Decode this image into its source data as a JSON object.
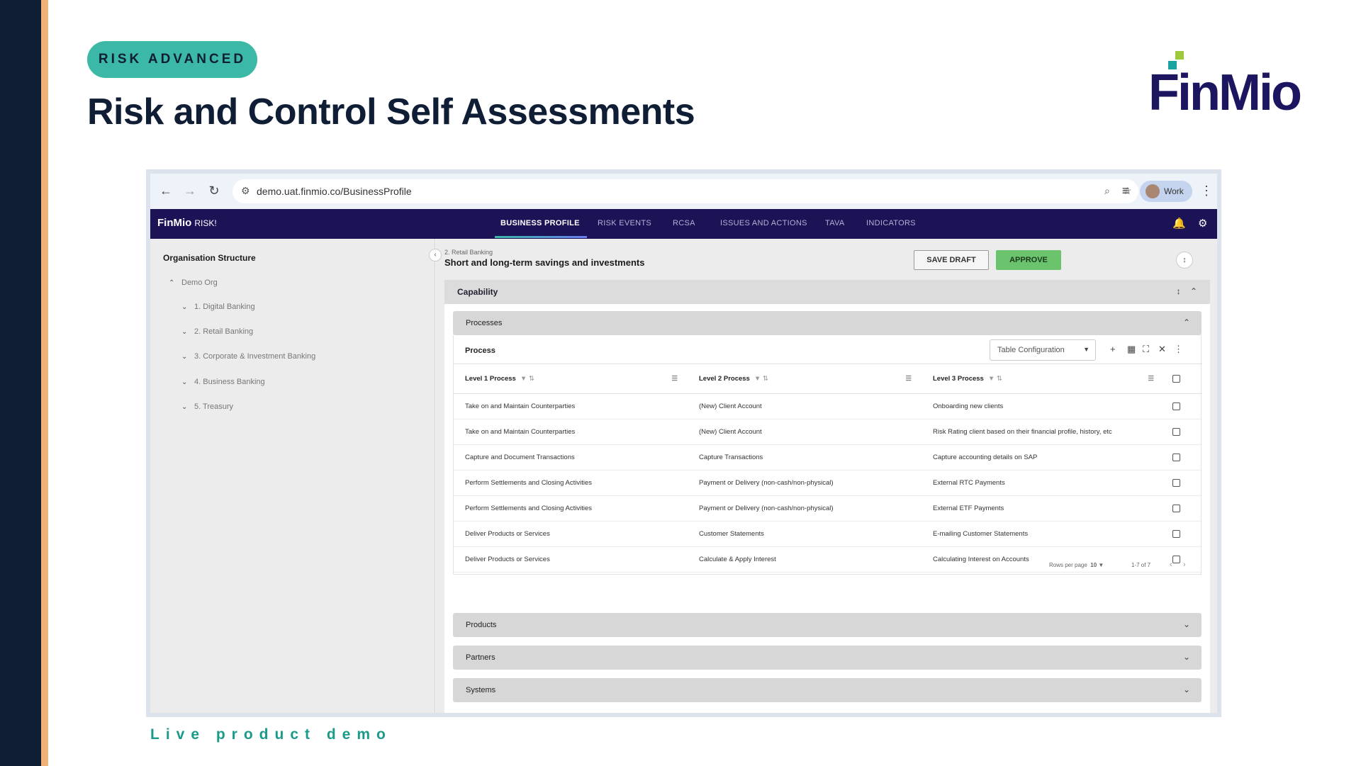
{
  "slide": {
    "pill_label": "RISK ADVANCED",
    "title": "Risk and Control Self Assessments",
    "caption": "Live product demo",
    "logo_text": "FinMio"
  },
  "browser": {
    "url": "demo.uat.finmio.co/BusinessProfile",
    "profile_label": "Work"
  },
  "app": {
    "logo": "FinMio",
    "logo_sub": "RISK!",
    "tabs": [
      "BUSINESS PROFILE",
      "RISK EVENTS",
      "RCSA",
      "ISSUES AND ACTIONS",
      "TAVA",
      "INDICATORS"
    ],
    "active_tab": "BUSINESS PROFILE"
  },
  "sidebar": {
    "title": "Organisation Structure",
    "root": "Demo Org",
    "items": [
      "1. Digital Banking",
      "2. Retail Banking",
      "3. Corporate & Investment Banking",
      "4. Business Banking",
      "5. Treasury"
    ]
  },
  "main": {
    "breadcrumb": "2. Retail Banking",
    "heading": "Short and long-term savings and investments",
    "save_draft": "SAVE DRAFT",
    "approve": "APPROVE",
    "capability": "Capability",
    "processes_section": "Processes",
    "process_label": "Process",
    "table_config": "Table Configuration",
    "columns": [
      "Level 1 Process",
      "Level 2 Process",
      "Level 3 Process"
    ],
    "rows": [
      [
        "Take on and Maintain Counterparties",
        "(New) Client Account",
        "Onboarding new clients"
      ],
      [
        "Take on and Maintain Counterparties",
        "(New) Client Account",
        "Risk Rating client based on their financial profile, history, etc"
      ],
      [
        "Capture and Document Transactions",
        "Capture Transactions",
        "Capture accounting details on SAP"
      ],
      [
        "Perform Settlements and Closing Activities",
        "Payment or Delivery (non-cash/non-physical)",
        "External RTC Payments"
      ],
      [
        "Perform Settlements and Closing Activities",
        "Payment or Delivery (non-cash/non-physical)",
        "External ETF Payments"
      ],
      [
        "Deliver Products or Services",
        "Customer Statements",
        "E-mailing Customer Statements"
      ],
      [
        "Deliver Products or Services",
        "Calculate & Apply Interest",
        "Calculating Interest on Accounts"
      ]
    ],
    "rows_per_page_label": "Rows per page",
    "rows_per_page": "10",
    "page_range": "1-7 of 7",
    "collapsed_sections": [
      "Products",
      "Partners",
      "Systems"
    ]
  },
  "colors": {
    "navy": "#0f1e35",
    "teal": "#3bb8a6",
    "orange": "#f1b27a",
    "app_nav": "#1c1256",
    "approve": "#6cc36e"
  }
}
